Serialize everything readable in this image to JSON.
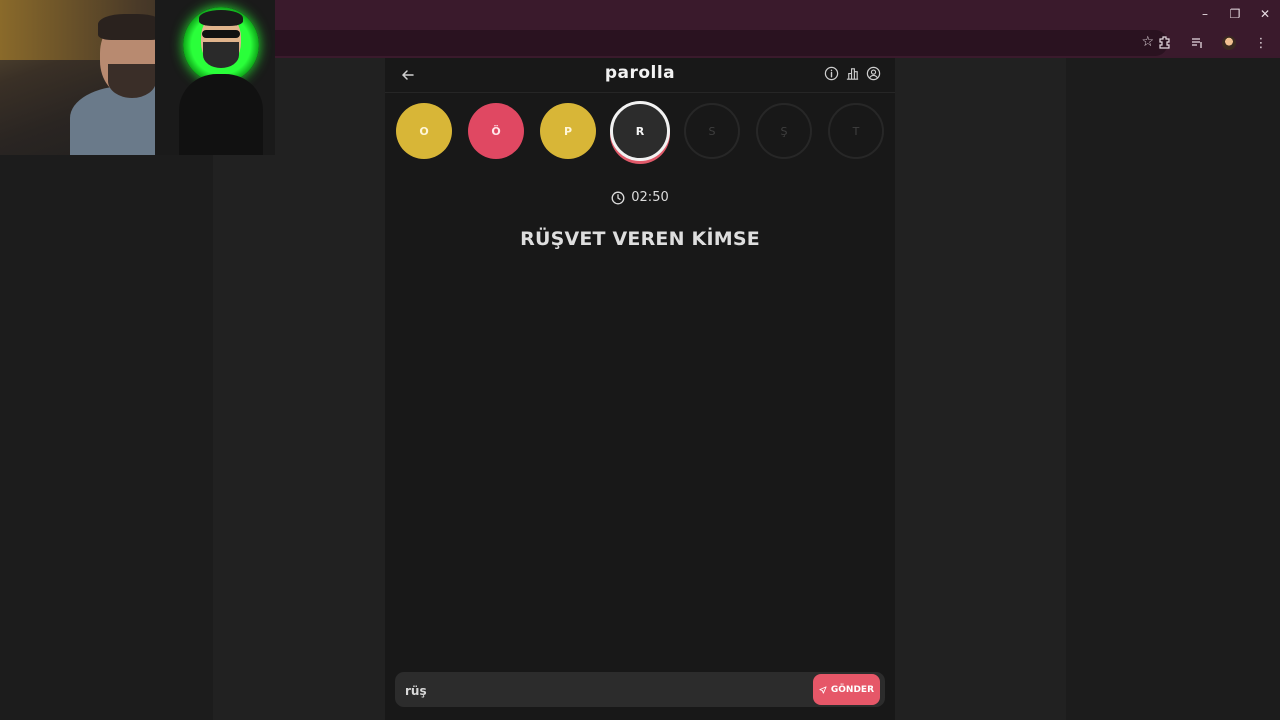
{
  "browser": {
    "window_controls": {
      "minimize": "–",
      "restore": "❐",
      "close": "✕"
    },
    "toolbar_icons": [
      "star-icon",
      "extensions-icon",
      "media-icon",
      "profile-avatar",
      "menu-icon"
    ]
  },
  "app": {
    "title": "parolla",
    "letters": [
      {
        "char": "O",
        "state": "correct"
      },
      {
        "char": "Ö",
        "state": "wrong"
      },
      {
        "char": "P",
        "state": "correct"
      },
      {
        "char": "R",
        "state": "current"
      },
      {
        "char": "S",
        "state": "pending"
      },
      {
        "char": "Ş",
        "state": "pending"
      },
      {
        "char": "T",
        "state": "pending"
      }
    ],
    "timer": "02:50",
    "question": "RÜŞVET VEREN KİMSE",
    "answer": {
      "value": "rüş"
    },
    "send_label": "GÖNDER"
  },
  "colors": {
    "correct": "#d8b637",
    "wrong": "#e04862",
    "send": "#e65768"
  }
}
